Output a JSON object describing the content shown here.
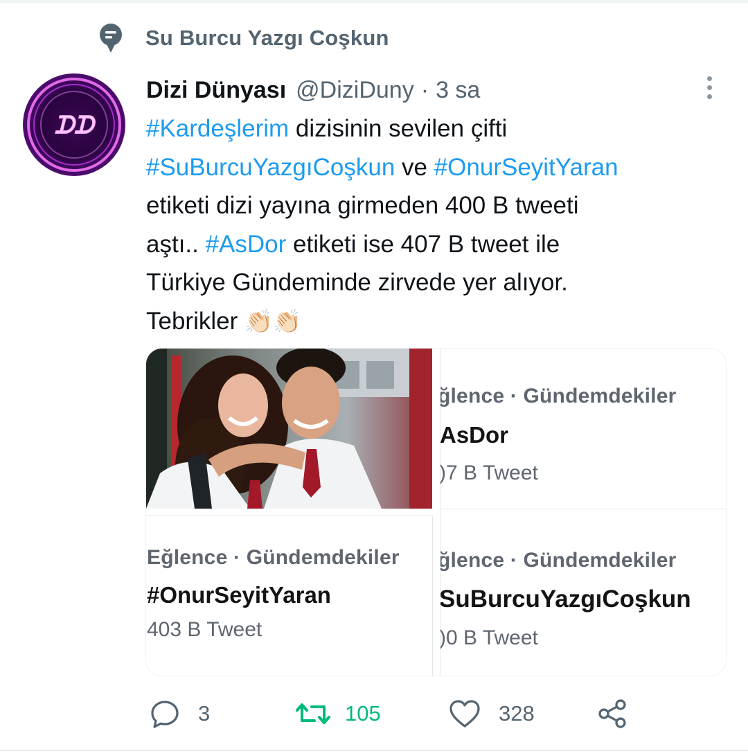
{
  "social_context": {
    "text": "Su Burcu Yazgı Coşkun",
    "icon": "pinned-comment-icon"
  },
  "author": {
    "name": "Dizi Dünyası",
    "handle": "@DiziDuny",
    "separator": "·",
    "time": "3 sa",
    "avatar_text": "ᗪᗪ"
  },
  "tweet": {
    "lines": [
      [
        {
          "text": "#Kardeşlerim",
          "hashtag": true
        },
        {
          "text": " dizisinin sevilen çifti",
          "hashtag": false
        }
      ],
      [
        {
          "text": "#SuBurcuYazgıCoşkun",
          "hashtag": true
        },
        {
          "text": " ve ",
          "hashtag": false
        },
        {
          "text": "#OnurSeyitYaran",
          "hashtag": true
        }
      ],
      [
        {
          "text": "etiketi dizi yayına girmeden 400 B tweeti",
          "hashtag": false
        }
      ],
      [
        {
          "text": "aştı.. ",
          "hashtag": false
        },
        {
          "text": "#AsDor",
          "hashtag": true
        },
        {
          "text": " etiketi ise 407 B tweet ile",
          "hashtag": false
        }
      ],
      [
        {
          "text": "Türkiye Gündeminde zirvede yer alıyor.",
          "hashtag": false
        }
      ],
      [
        {
          "text": "Tebrikler ",
          "hashtag": false
        },
        {
          "text": "👏🏻👏🏻",
          "hashtag": false,
          "emoji": true
        }
      ]
    ]
  },
  "media": {
    "photo_alt": "two-people-selfie-photo",
    "tiles": [
      {
        "category": "ğlence · Gündemdekiler",
        "tag": "AsDor",
        "count": ")7 B Tweet"
      },
      {
        "category": "Eğlence · Gündemdekiler",
        "tag": "#OnurSeyitYaran",
        "count": "403 B Tweet"
      },
      {
        "category": "ğlence · Gündemdekiler",
        "tag": "SuBurcuYazgıCoşkun",
        "count": ")0 B Tweet"
      }
    ]
  },
  "actions": {
    "reply": {
      "icon": "reply-icon",
      "count": "3"
    },
    "retweet": {
      "icon": "retweet-icon",
      "count": "105",
      "active": true,
      "color": "#00ba7c"
    },
    "like": {
      "icon": "heart-icon",
      "count": "328"
    },
    "share": {
      "icon": "share-icon"
    }
  },
  "colors": {
    "hashtag": "#1d9bf0",
    "secondary_text": "#536471",
    "retweet_active": "#00ba7c"
  }
}
